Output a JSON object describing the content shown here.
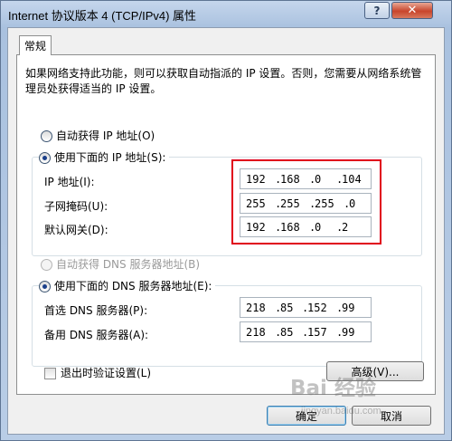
{
  "window": {
    "title": "Internet 协议版本 4 (TCP/IPv4) 属性",
    "help_glyph": "?",
    "close_glyph": "✕"
  },
  "tab": {
    "label": "常规"
  },
  "description": "如果网络支持此功能，则可以获取自动指派的 IP 设置。否则，您需要从网络系统管理员处获得适当的 IP 设置。",
  "ip": {
    "auto_label": "自动获得 IP 地址(O)",
    "manual_label": "使用下面的 IP 地址(S):",
    "address_label": "IP 地址(I):",
    "subnet_label": "子网掩码(U):",
    "gateway_label": "默认网关(D):",
    "address": [
      "192",
      "168",
      "0",
      "104"
    ],
    "subnet": [
      "255",
      "255",
      "255",
      "0"
    ],
    "gateway": [
      "192",
      "168",
      "0",
      "2"
    ]
  },
  "dns": {
    "auto_label": "自动获得 DNS 服务器地址(B)",
    "manual_label": "使用下面的 DNS 服务器地址(E):",
    "preferred_label": "首选 DNS 服务器(P):",
    "alternate_label": "备用 DNS 服务器(A):",
    "preferred": [
      "218",
      "85",
      "152",
      "99"
    ],
    "alternate": [
      "218",
      "85",
      "157",
      "99"
    ]
  },
  "validate_label": "退出时验证设置(L)",
  "advanced_label": "高级(V)...",
  "ok_label": "确定",
  "cancel_label": "取消",
  "watermark": {
    "text": "Bai 经验",
    "sub": "jingyan.baidu.com"
  },
  "colors": {
    "highlight_border": "#e0001b",
    "radio_dot": "#1a3f8a"
  }
}
